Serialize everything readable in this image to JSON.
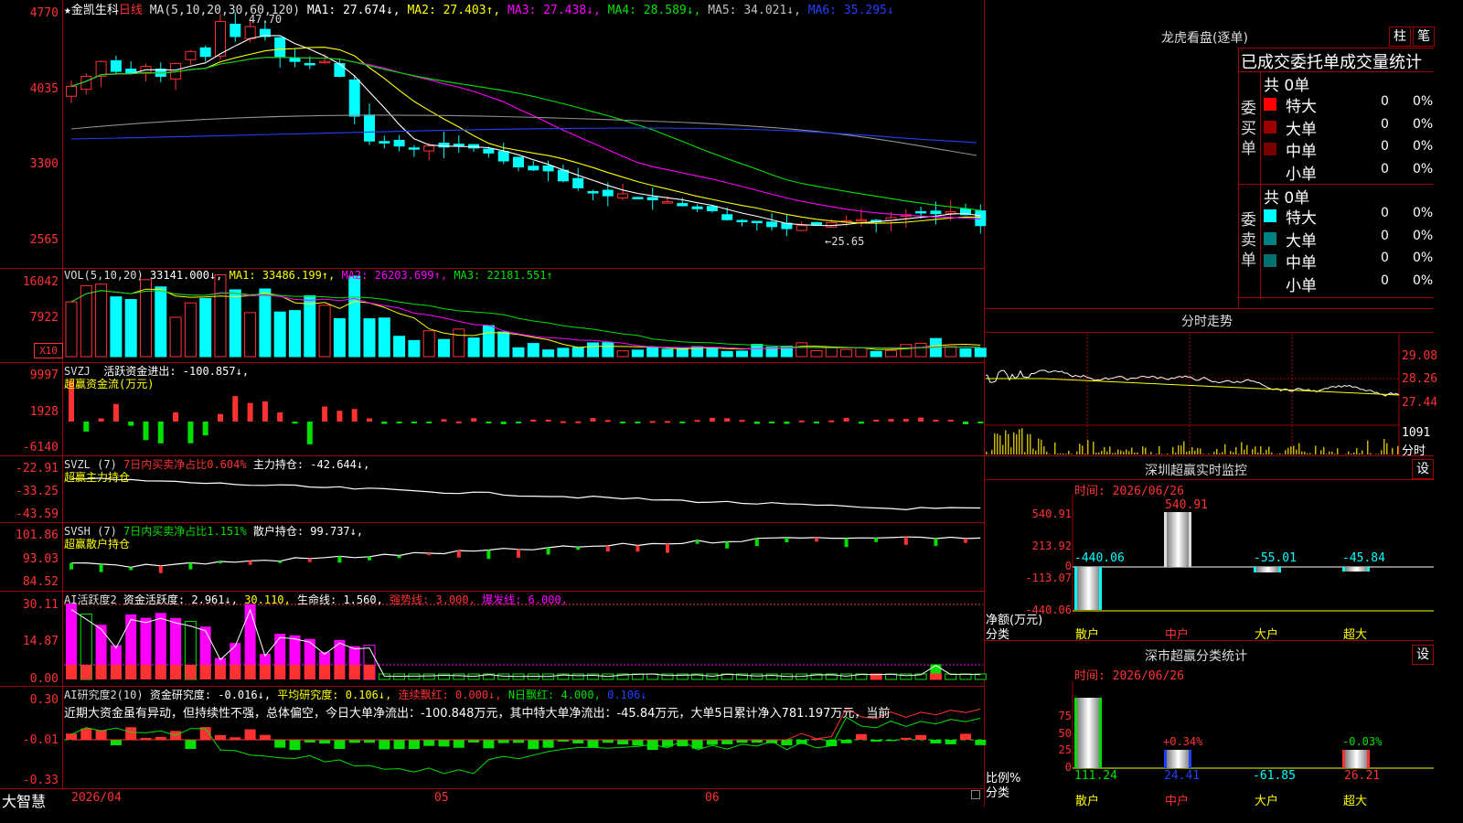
{
  "colors": {
    "up": "#ff3232",
    "down": "#00ffff",
    "grid": "#a00000",
    "bg": "#000000",
    "white": "#ffffff",
    "yellow": "#ffff00",
    "magenta": "#ff00ff",
    "green": "#00e000",
    "blue": "#2040ff",
    "gray": "#909090"
  },
  "main_panel": {
    "star": "★",
    "stock_name": "金凯生科",
    "period": "日线",
    "ma_def": "MA(5,10,20,30,60,120)",
    "ma1": "MA1: 27.674↓,",
    "ma2": "MA2: 27.403↑,",
    "ma3": "MA3: 27.438↓,",
    "ma4": "MA4: 28.589↓,",
    "ma5": "MA5: 34.021↓,",
    "ma6": "MA6: 35.295↓",
    "y_ticks": [
      "4770",
      "4035",
      "3300",
      "2565"
    ],
    "high_label": "47.70",
    "low_label": "←25.65"
  },
  "vol_panel": {
    "title": "VOL(5,10,20)",
    "value": "33141.000↓,",
    "ma1": "MA1: 33486.199↑,",
    "ma2": "MA2: 26203.699↑,",
    "ma3": "MA3: 22181.551↑",
    "y_ticks": [
      "16042",
      "7922"
    ],
    "unit": "X10"
  },
  "svzj_panel": {
    "title": "SVZJ",
    "desc": "活跃资金进出: -100.857↓,",
    "sub": "超赢资金流(万元)",
    "y_ticks": [
      "9997",
      "1928",
      "-6140"
    ]
  },
  "svzl_panel": {
    "title": "SVZL (7)",
    "desc1": "7日内买卖净占比0.604%",
    "desc2": "主力持仓: -42.644↓,",
    "sub": "超赢主力持仓",
    "y_ticks": [
      "-22.91",
      "-33.25",
      "-43.59"
    ]
  },
  "svsh_panel": {
    "title": "SVSH (7)",
    "desc1": "7日内买卖净占比1.151%",
    "desc2": "散户持仓: 99.737↓,",
    "sub": "超赢散户持仓",
    "y_ticks": [
      "101.86",
      "93.03",
      "84.52"
    ]
  },
  "ai_panel": {
    "title": "AI活跃度2",
    "v1": "资金活跃度: 2.961↓,",
    "v2": "30.110,",
    "v3": "生命线: 1.560,",
    "v4": "强势线: 3.000,",
    "v5": "爆发线: 6.000,",
    "y_ticks": [
      "30.11",
      "14.87",
      "0.00"
    ]
  },
  "research_panel": {
    "title": "AI研究度2(10)",
    "v1": "资金研究度: -0.016↓,",
    "v2": "平均研究度: 0.106↓,",
    "v3": "连续飘红: 0.000↓,",
    "v4": "N日飘红: 4.000,",
    "v5": "0.106↓",
    "text": "近期大资金虽有异动，但持续性不强，总体偏空，今日大单净流出：-100.848万元，其中特大单净流出：-45.84万元，大单5日累计净入781.197万元，当前",
    "y_ticks": [
      "0.30",
      "-0.01",
      "-0.33"
    ]
  },
  "x_axis": {
    "brand": "大智慧",
    "date_start": "2026/04",
    "m05": "05",
    "m06": "06"
  },
  "right": {
    "lhb_title": "龙虎看盘(逐单)",
    "btn_bar": "柱",
    "btn_pen": "笔",
    "stats_header": "已成交委托单成交量统计",
    "buy_side": "委买单",
    "sell_side": "委卖单",
    "buy_total": "共 0单",
    "sell_total": "共 0单",
    "rows": [
      {
        "label": "特大",
        "value": "0",
        "pct": "0%",
        "color": "#ff0000"
      },
      {
        "label": "大单",
        "value": "0",
        "pct": "0%",
        "color": "#9a0000"
      },
      {
        "label": "中单",
        "value": "0",
        "pct": "0%",
        "color": "#7a0000"
      },
      {
        "label": "小单",
        "value": "0",
        "pct": "0%",
        "color": ""
      }
    ],
    "sell_rows": [
      {
        "label": "特大",
        "value": "0",
        "pct": "0%",
        "color": "#00ffff"
      },
      {
        "label": "大单",
        "value": "0",
        "pct": "0%",
        "color": "#008080"
      },
      {
        "label": "中单",
        "value": "0",
        "pct": "0%",
        "color": "#007070"
      },
      {
        "label": "小单",
        "value": "0",
        "pct": "0%",
        "color": ""
      }
    ],
    "minute_title": "分时走势",
    "minute_ticks": [
      "29.08",
      "28.26",
      "27.44",
      "1091"
    ],
    "minute_unit": "分时",
    "sz_title": "深圳超赢实时监控",
    "sz_btn": "设",
    "sz_time": "时间: 2026/06/26",
    "sz_y": [
      "540.91",
      "213.92",
      "0",
      "-113.07",
      "-440.06"
    ],
    "sz_vals": [
      "-440.06",
      "540.91",
      "-55.01",
      "-45.84"
    ],
    "sz_yl1": "净额(万元)",
    "sz_yl2": "分类",
    "cats": [
      "散户",
      "中户",
      "大户",
      "超大"
    ],
    "fl_title": "深市超赢分类统计",
    "fl_btn": "设",
    "fl_time": "时间: 2026/06/26",
    "fl_y": [
      "75",
      "50",
      "25",
      "0"
    ],
    "fl_pct": [
      "+0.34%",
      "-0.03%"
    ],
    "fl_vals": [
      "111.24",
      "24.41",
      "-61.85",
      "26.21"
    ],
    "fl_yl1": "比例%",
    "fl_yl2": "分类"
  },
  "chart_data": {
    "type": "candlestick",
    "title": "金凯生科",
    "sz_monitor": {
      "categories": [
        "散户",
        "中户",
        "大户",
        "超大"
      ],
      "values": [
        -440.06,
        540.91,
        -55.01,
        -45.84
      ]
    },
    "fl_stats": {
      "categories": [
        "散户",
        "中户",
        "大户",
        "超大"
      ],
      "values": [
        111.24,
        24.41,
        -61.85,
        26.21
      ]
    }
  }
}
